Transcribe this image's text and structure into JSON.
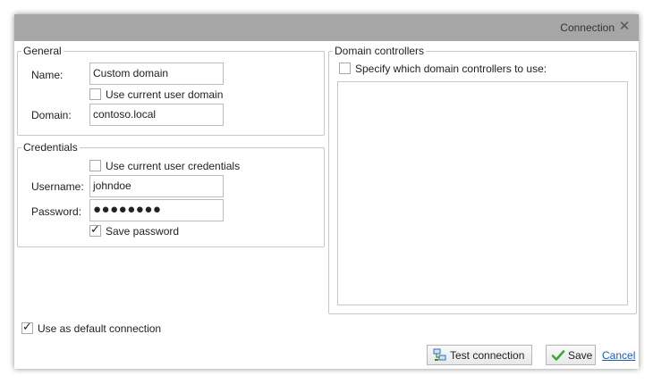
{
  "dialog": {
    "title": "Connection",
    "close_glyph": "✕"
  },
  "general": {
    "legend": "General",
    "name_label": "Name:",
    "name_value": "Custom domain",
    "use_current_domain_label": "Use current user domain",
    "use_current_domain_checked": false,
    "domain_label": "Domain:",
    "domain_value": "contoso.local"
  },
  "credentials": {
    "legend": "Credentials",
    "use_current_credentials_label": "Use current user credentials",
    "use_current_credentials_checked": false,
    "username_label": "Username:",
    "username_value": "johndoe",
    "password_label": "Password:",
    "password_mask": "●●●●●●●●",
    "save_password_label": "Save password",
    "save_password_checked": true
  },
  "domain_controllers": {
    "legend": "Domain controllers",
    "specify_label": "Specify which domain controllers to use:",
    "specify_checked": false,
    "items": []
  },
  "footer": {
    "default_connection_label": "Use as default connection",
    "default_connection_checked": true,
    "test_button_label": "Test connection",
    "save_button_label": "Save",
    "cancel_link_label": "Cancel",
    "check_glyph": "✓",
    "accent_green": "#3aa935",
    "link_color": "#1a5eb8"
  },
  "icons": [
    "close-icon",
    "network-icon",
    "checkmark-icon"
  ]
}
